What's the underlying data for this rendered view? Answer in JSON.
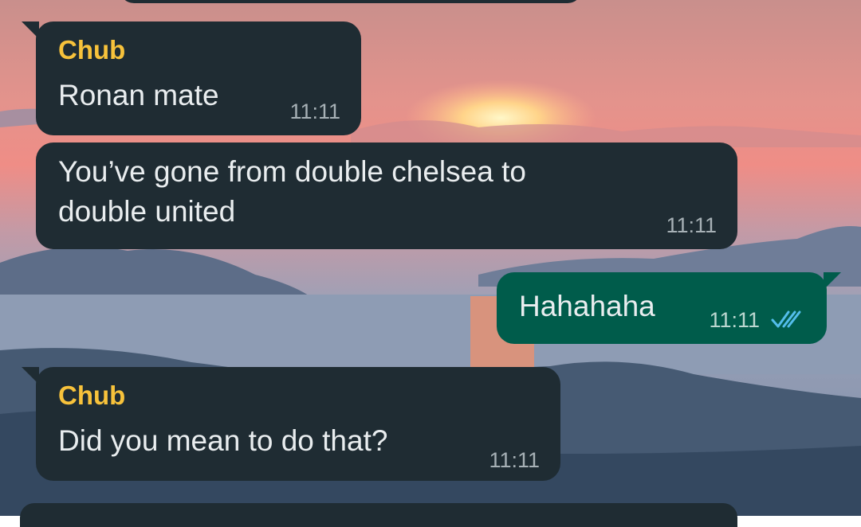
{
  "chat": {
    "messages": [
      {
        "sender": "Chub",
        "text": "Ronan mate",
        "time": "11:11"
      },
      {
        "text": "You’ve gone from double chelsea to double united",
        "time": "11:11"
      },
      {
        "text": "Hahahaha",
        "time": "11:11",
        "status": "read"
      },
      {
        "sender": "Chub",
        "text": "Did you mean to do that?",
        "time": "11:11"
      }
    ]
  },
  "colors": {
    "incoming_bubble": "#1f2c33",
    "outgoing_bubble": "#005c4b",
    "sender_name": "#f7c23b",
    "read_ticks": "#53bdeb"
  },
  "icons": {
    "read_receipt": "double-check-icon"
  }
}
